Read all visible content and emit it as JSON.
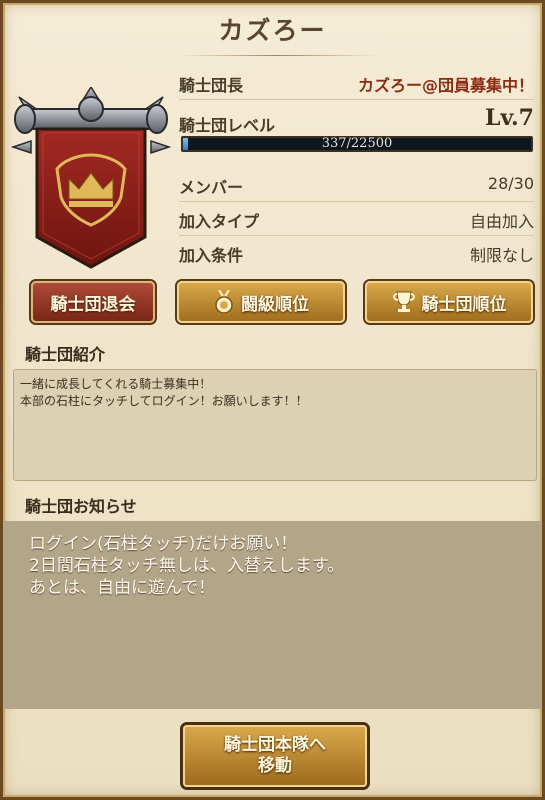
{
  "header": {
    "title": "カズろー"
  },
  "info": {
    "leader_label": "騎士団長",
    "leader_value": "カズろー@団員募集中！",
    "level_label": "騎士団レベル",
    "level_value": "Lv.7",
    "xp_text": "337/22500",
    "xp_fraction": 0.015,
    "members_label": "メンバー",
    "members_value": "28/30",
    "join_type_label": "加入タイプ",
    "join_type_value": "自由加入",
    "join_cond_label": "加入条件",
    "join_cond_value": "制限なし"
  },
  "buttons": {
    "leave": "騎士団退会",
    "battle_rank": "闘級順位",
    "guild_rank": "騎士団順位",
    "move_line1": "騎士団本隊へ",
    "move_line2": "移動"
  },
  "intro": {
    "title": "騎士団紹介",
    "lines": [
      "一緒に成長してくれる騎士募集中！",
      "本部の石柱にタッチしてログイン！お願いします！！"
    ]
  },
  "notice": {
    "title": "騎士団お知らせ",
    "lines": [
      "ログイン(石柱タッチ)だけお願い！",
      "2日間石柱タッチ無しは、入替えします。",
      "あとは、自由に遊んで！"
    ]
  },
  "icons": {
    "emblem": "crown-banner-icon",
    "medal": "medal-icon",
    "trophy": "trophy-icon"
  },
  "colors": {
    "banner_red": "#8e1b17",
    "gold": "#d8a84a",
    "xp_blue": "#3a9be8"
  }
}
